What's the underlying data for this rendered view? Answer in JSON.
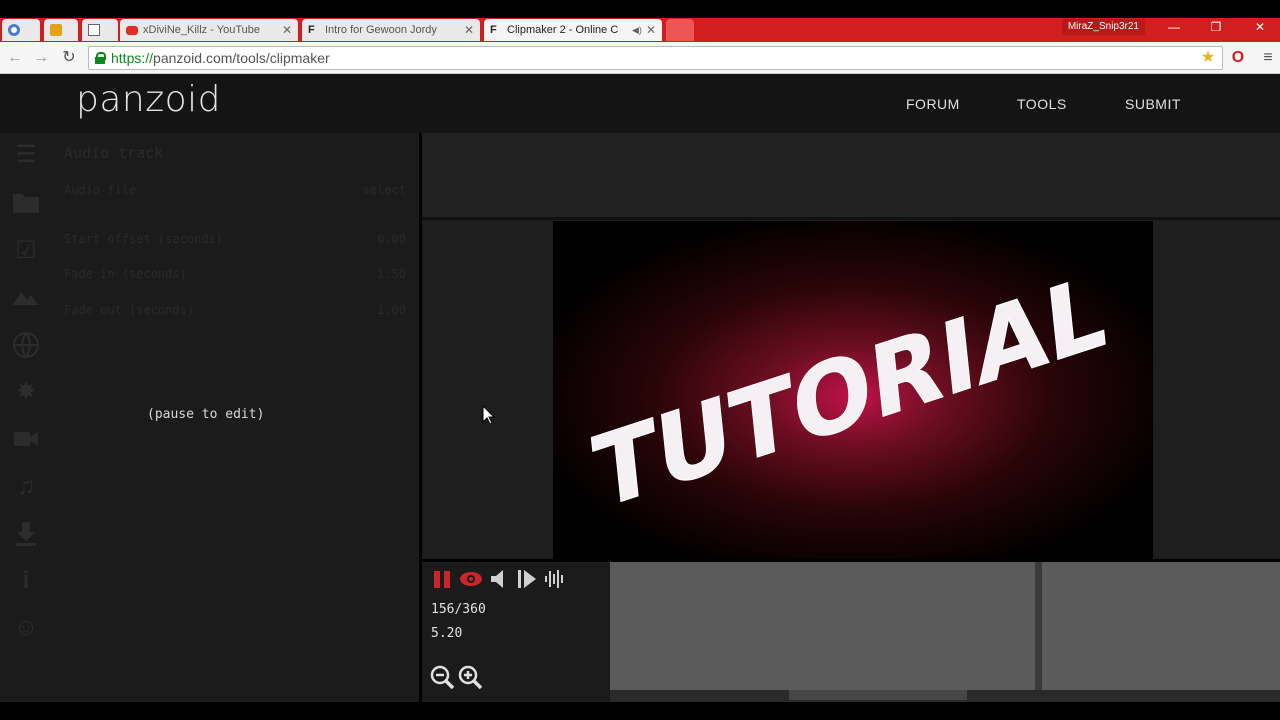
{
  "browser": {
    "tabs": [
      {
        "label": "",
        "icon": "chrome-icon"
      },
      {
        "label": "",
        "icon": "extension-icon"
      },
      {
        "label": "",
        "icon": "page-icon"
      },
      {
        "label": "xDiviNe_Killz - YouTube",
        "icon": "youtube-icon"
      },
      {
        "label": "Intro for Gewoon Jordy",
        "icon": "panzoid-icon"
      },
      {
        "label": "Clipmaker 2 - Online C",
        "icon": "panzoid-icon",
        "active": true
      }
    ],
    "profile_name": "MiraZ_Snip3r21",
    "url_scheme": "https://",
    "url_rest": "panzoid.com/tools/clipmaker",
    "accent": "#d11f1f"
  },
  "header": {
    "logo": "panzoid",
    "nav": [
      "FORUM",
      "TOOLS",
      "SUBMIT"
    ]
  },
  "sidebar": {
    "icons": [
      "menu-icon",
      "folder-icon",
      "checkbox-icon",
      "image-icon",
      "globe-icon",
      "burst-icon",
      "camera-icon",
      "music-icon",
      "download-icon",
      "info-icon",
      "smiley-icon"
    ]
  },
  "pane": {
    "title": "Audio track",
    "properties": [
      {
        "label": "Audio file",
        "value": "select"
      },
      {
        "label": "Start offset (seconds)",
        "value": "0.00"
      },
      {
        "label": "Fade in (seconds)",
        "value": "1.50"
      },
      {
        "label": "Fade out (seconds)",
        "value": "1.00"
      }
    ],
    "pause_message": "(pause to edit)"
  },
  "player": {
    "frame": "156/360",
    "time": "5.20",
    "controls": [
      "pause-icon",
      "eye-icon",
      "volume-icon",
      "step-forward-icon",
      "waveform-icon"
    ],
    "zoom": [
      "zoom-out-icon",
      "zoom-in-icon"
    ]
  },
  "preview": {
    "intro_text": "TUTORIAL"
  }
}
